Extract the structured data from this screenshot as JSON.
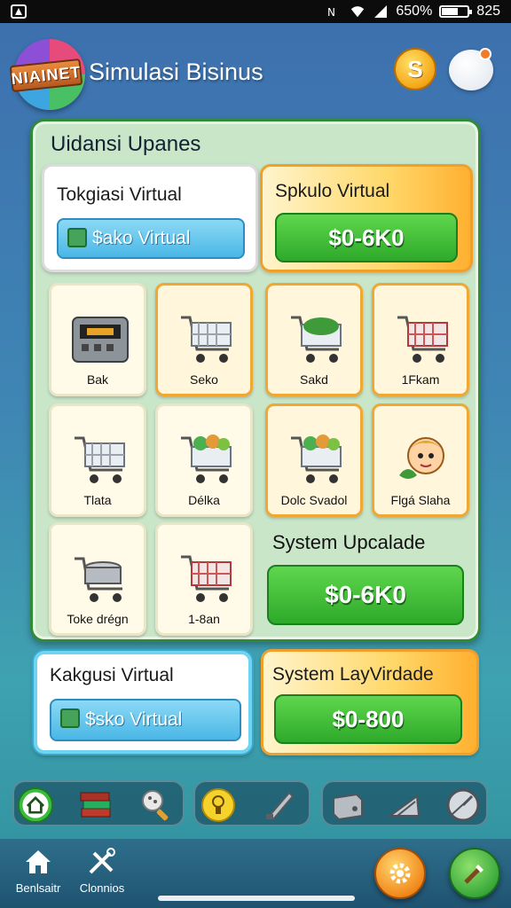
{
  "status_bar": {
    "battery_text": "650%",
    "battery_level_percent": 65,
    "time": "825"
  },
  "header": {
    "logo_text": "NIAINET",
    "title": "Simulasi Bisinus",
    "coin_symbol": "S"
  },
  "main_panel": {
    "title": "Uidansi Upanes",
    "top_left_card": {
      "title": "Tokgiasi Virtual",
      "button_label": "$ako Virtual"
    },
    "top_right_card": {
      "title": "Spkulo Virtual",
      "button_label": "$0-6K0"
    },
    "items": [
      {
        "label": "Bak",
        "icon": "register-icon",
        "selected": false
      },
      {
        "label": "Seko",
        "icon": "cart-icon",
        "selected": true
      },
      {
        "label": "Sakd",
        "icon": "cart-vegetables-icon",
        "selected": true
      },
      {
        "label": "1Fkam",
        "icon": "cart-red-icon",
        "selected": true
      },
      {
        "label": "Tlata",
        "icon": "cart-icon",
        "selected": false
      },
      {
        "label": "Délka",
        "icon": "cart-produce-icon",
        "selected": false
      },
      {
        "label": "Dolc Svadol",
        "icon": "cart-produce-icon",
        "selected": true
      },
      {
        "label": "Flgá Slaha",
        "icon": "character-icon",
        "selected": true
      },
      {
        "label": "Toke drégn",
        "icon": "pot-cart-icon",
        "selected": false
      },
      {
        "label": "1-8an",
        "icon": "cart-red-icon",
        "selected": false
      }
    ],
    "upgrade_card": {
      "title": "System Upcalade",
      "button_label": "$0-6K0"
    }
  },
  "bottom_left_card": {
    "title": "Kakgusi Virtual",
    "button_label": "$ѕkо Virtual"
  },
  "bottom_right_card": {
    "title": "System LayVirdade",
    "button_label": "$0-800"
  },
  "toolbar": {
    "groups": [
      [
        "home-icon",
        "books-icon",
        "magnifier-icon"
      ],
      [
        "lightbulb-icon",
        "knife-icon"
      ],
      [
        "safe-icon",
        "ramp-icon",
        "gauge-icon"
      ]
    ]
  },
  "bottom_nav": {
    "items": [
      {
        "label": "Benlsaitr",
        "icon": "house-icon"
      },
      {
        "label": "Clonnios",
        "icon": "tools-icon"
      }
    ]
  },
  "colors": {
    "primary_green": "#2ea92a",
    "accent_orange": "#f0a02a",
    "button_blue": "#4ab7e6"
  }
}
